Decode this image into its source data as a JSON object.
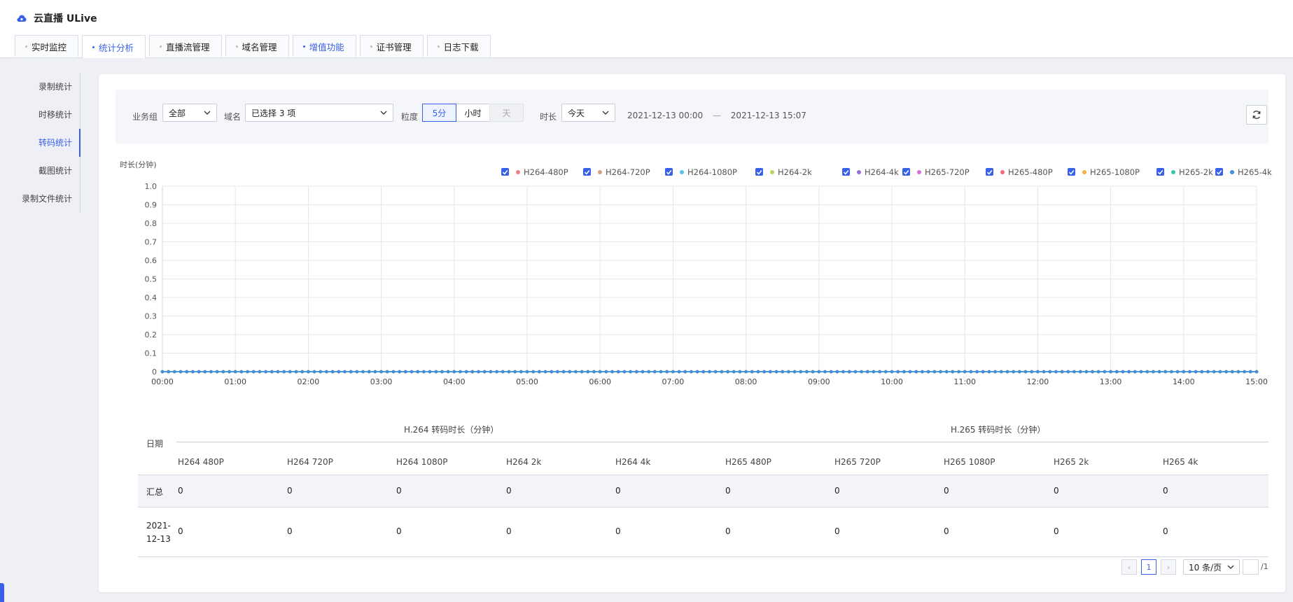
{
  "app": {
    "title": "云直播 ULive",
    "accent": "#3860e8"
  },
  "tabs": [
    {
      "label": "实时监控",
      "state": "normal"
    },
    {
      "label": "统计分析",
      "state": "active"
    },
    {
      "label": "直播流管理",
      "state": "normal"
    },
    {
      "label": "域名管理",
      "state": "normal"
    },
    {
      "label": "增值功能",
      "state": "highlight"
    },
    {
      "label": "证书管理",
      "state": "normal"
    },
    {
      "label": "日志下载",
      "state": "normal"
    }
  ],
  "sidebar": {
    "items": [
      {
        "label": "录制统计"
      },
      {
        "label": "时移统计"
      },
      {
        "label": "转码统计",
        "active": true
      },
      {
        "label": "截图统计"
      },
      {
        "label": "录制文件统计"
      }
    ]
  },
  "filters": {
    "group_label": "业务组",
    "group_value": "全部",
    "domain_label": "域名",
    "domain_value": "已选择 3 项",
    "granularity_label": "粒度",
    "granularity_options": [
      "5分",
      "小时",
      "天"
    ],
    "granularity_selected": "5分",
    "duration_label": "时长",
    "duration_value": "今天",
    "date_start": "2021-12-13 00:00",
    "date_sep": "—",
    "date_end": "2021-12-13 15:07"
  },
  "chart_data": {
    "type": "line",
    "ylabel": "时长(分钟)",
    "ylim": [
      0,
      1.0
    ],
    "yticks": [
      "1.0",
      "0.9",
      "0.8",
      "0.7",
      "0.6",
      "0.5",
      "0.4",
      "0.3",
      "0.2",
      "0.1",
      "0"
    ],
    "x_ticks": [
      "00:00",
      "01:00",
      "02:00",
      "03:00",
      "04:00",
      "05:00",
      "06:00",
      "07:00",
      "08:00",
      "09:00",
      "10:00",
      "11:00",
      "12:00",
      "13:00",
      "14:00",
      "15:00"
    ],
    "x_range": [
      "00:00",
      "15:00"
    ],
    "x_step": "5分",
    "grid": true,
    "legend_position": "top-right",
    "series": [
      {
        "name": "H264-480P",
        "color": "#f08080",
        "values_constant": 0
      },
      {
        "name": "H264-720P",
        "color": "#d9a07a",
        "values_constant": 0
      },
      {
        "name": "H264-1080P",
        "color": "#5bc0f0",
        "values_constant": 0
      },
      {
        "name": "H264-2k",
        "color": "#b9d45a",
        "values_constant": 0
      },
      {
        "name": "H264-4k",
        "color": "#9a6be0",
        "values_constant": 0
      },
      {
        "name": "H265-720P",
        "color": "#d66fd9",
        "values_constant": 0
      },
      {
        "name": "H265-480P",
        "color": "#ef6b7d",
        "values_constant": 0
      },
      {
        "name": "H265-1080P",
        "color": "#f5b13b",
        "values_constant": 0
      },
      {
        "name": "H265-2k",
        "color": "#36c9a8",
        "values_constant": 0
      },
      {
        "name": "H265-4k",
        "color": "#3f8fe0",
        "values_constant": 0
      }
    ]
  },
  "table": {
    "date_header": "日期",
    "group_h264": "H.264 转码时长（分钟）",
    "group_h265": "H.265 转码时长（分钟）",
    "columns": [
      "H264 480P",
      "H264 720P",
      "H264 1080P",
      "H264 2k",
      "H264 4k",
      "H265 480P",
      "H265 720P",
      "H265 1080P",
      "H265 2k",
      "H265 4k"
    ],
    "rows": [
      {
        "date": "汇总",
        "values": [
          "0",
          "0",
          "0",
          "0",
          "0",
          "0",
          "0",
          "0",
          "0",
          "0"
        ]
      },
      {
        "date": "2021-12-13",
        "values": [
          "0",
          "0",
          "0",
          "0",
          "0",
          "0",
          "0",
          "0",
          "0",
          "0"
        ]
      }
    ]
  },
  "pagination": {
    "prev": "‹",
    "current": "1",
    "next": "›",
    "page_size": "10 条/页",
    "jump_value": "",
    "total_pages": "/1"
  }
}
